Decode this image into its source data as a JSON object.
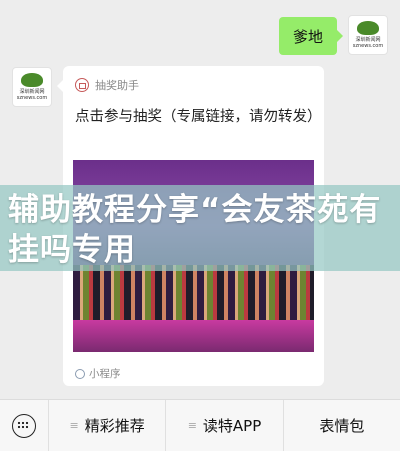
{
  "chat": {
    "outgoing_message": "爹地",
    "avatar_right": {
      "line1": "深圳新闻网",
      "line2": "sznews.com"
    },
    "avatar_left": {
      "line1": "深圳新闻网",
      "line2": "sznews.com"
    }
  },
  "card": {
    "mini_program_name": "抽奖助手",
    "title": "点击参与抽奖（专属链接，请勿转发）",
    "footer_label": "小程序"
  },
  "overlay": {
    "headline": "辅助教程分享“会友茶苑有挂吗专用"
  },
  "bottom_menu": {
    "items": [
      "精彩推荐",
      "读特APP",
      "表情包"
    ]
  },
  "colors": {
    "bubble_green": "#95ec69",
    "background": "#ededed",
    "overlay": "#96c8c3"
  },
  "icons": {
    "keyboard": "keyboard-icon",
    "gift": "gift-icon",
    "mini_program": "mini-program-icon",
    "menu_lines": "menu-lines-icon"
  }
}
